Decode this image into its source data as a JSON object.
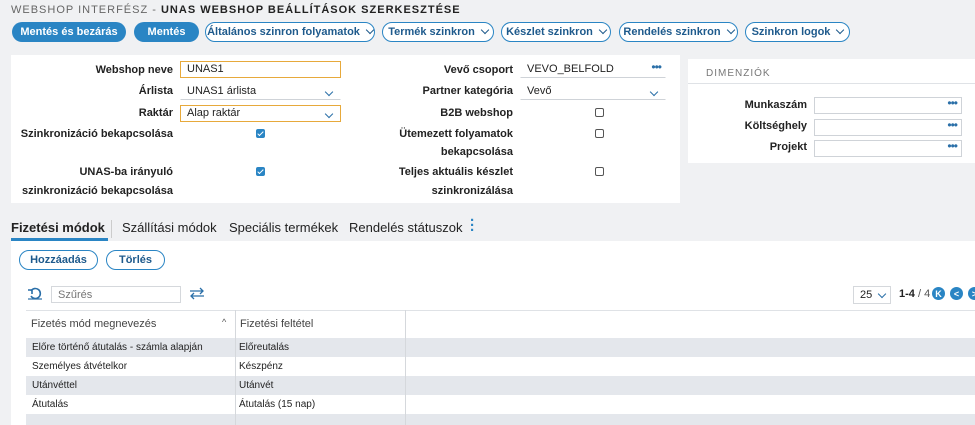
{
  "breadcrumb": {
    "parent": "WEBSHOP INTERFÉSZ -",
    "current": "UNAS WEBSHOP BEÁLLÍTÁSOK SZERKESZTÉSE"
  },
  "toolbar": {
    "save_close": "Mentés és bezárás",
    "save": "Mentés",
    "general_sync": "Általános szinron folyamatok",
    "product_sync": "Termék szinkron",
    "stock_sync": "Készlet szinkron",
    "order_sync": "Rendelés szinkron",
    "sync_logs": "Szinkron logok"
  },
  "form": {
    "webshop_name_label": "Webshop neve",
    "webshop_name_value": "UNAS1",
    "price_list_label": "Árlista",
    "price_list_value": "UNAS1 árlista",
    "warehouse_label": "Raktár",
    "warehouse_value": "Alap raktár",
    "sync_disable_label": "Szinkronizáció bekapcsolása",
    "sync_disable_checked": true,
    "unas_sync_label_1": "UNAS-ba irányuló",
    "unas_sync_label_2": "szinkronizáció bekapcsolása",
    "unas_sync_checked": true,
    "customer_group_label": "Vevő csoport",
    "customer_group_value": "VEVO_BELFOLD",
    "partner_category_label": "Partner kategória",
    "partner_category_value": "Vevő",
    "b2b_label": "B2B webshop",
    "b2b_checked": false,
    "scheduled_label_1": "Ütemezett folyamatok",
    "scheduled_label_2": "bekapcsolása",
    "scheduled_checked": false,
    "full_stock_label_1": "Teljes aktuális készlet",
    "full_stock_label_2": "szinkronizálása",
    "full_stock_checked": false
  },
  "dimensions": {
    "title": "DIMENZIÓK",
    "work_number": "Munkaszám",
    "cost_center": "Költséghely",
    "project": "Projekt"
  },
  "tabs": [
    "Fizetési módok",
    "Szállítási módok",
    "Speciális termékek",
    "Rendelés státuszok"
  ],
  "actions": {
    "add": "Hozzáadás",
    "delete": "Törlés"
  },
  "grid": {
    "filter_placeholder": "Szűrés",
    "page_size": "25",
    "range": "1-4",
    "total": "/ 4",
    "columns": [
      "Fizetés mód megnevezés",
      "Fizetési feltétel"
    ],
    "rows": [
      [
        "Előre történő átutalás - számla alapján",
        "Előreutalás"
      ],
      [
        "Személyes átvételkor",
        "Készpénz"
      ],
      [
        "Utánvéttel",
        "Utánvét"
      ],
      [
        "Átutalás",
        "Átutalás (15 nap)"
      ]
    ]
  },
  "colors": {
    "accent": "#2a85c4",
    "focus_border": "#e7a93b",
    "alt_row": "#e4e7ec"
  }
}
